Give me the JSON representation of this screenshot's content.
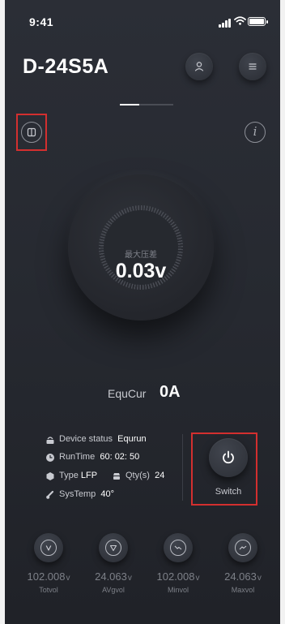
{
  "status_bar": {
    "time": "9:41"
  },
  "header": {
    "title": "D-24S5A"
  },
  "dial": {
    "label": "最大压差",
    "value": "0.03v"
  },
  "equcur": {
    "label": "EquCur",
    "value": "0A"
  },
  "info": {
    "device_status_label": "Device status",
    "device_status_value": "Equrun",
    "runtime_label": "RunTime",
    "runtime_value": "60: 02: 50",
    "type_label": "Type",
    "type_value": "LFP",
    "qty_label": "Qty(s)",
    "qty_value": "24",
    "systemp_label": "SysTemp",
    "systemp_value": "40°"
  },
  "switch": {
    "label": "Switch"
  },
  "stats": [
    {
      "value": "102.008",
      "unit": "v",
      "label": "Totvol",
      "icon": "voltage-v-icon"
    },
    {
      "value": "24.063",
      "unit": "v",
      "label": "AVgvol",
      "icon": "triangle-down-icon"
    },
    {
      "value": "102.008",
      "unit": "v",
      "label": "Minvol",
      "icon": "trend-down-icon"
    },
    {
      "value": "24.063",
      "unit": "v",
      "label": "Maxvol",
      "icon": "trend-up-icon"
    }
  ],
  "colors": {
    "background": "#262930",
    "highlight": "#d32f2f",
    "text_primary": "#ffffff",
    "text_muted": "#7d8088"
  }
}
